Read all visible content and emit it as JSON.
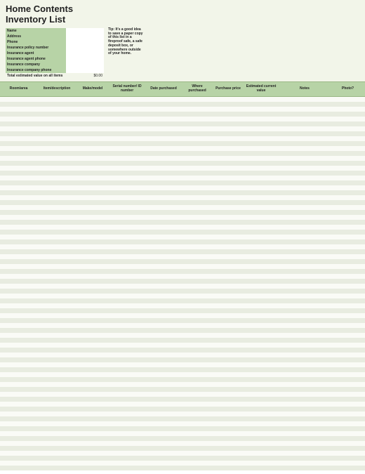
{
  "title_line1": "Home Contents",
  "title_line2": "Inventory List",
  "info": {
    "rows": [
      {
        "label": "Name",
        "value": ""
      },
      {
        "label": "Address",
        "value": ""
      },
      {
        "label": "Phone",
        "value": ""
      },
      {
        "label": "Insurance policy number",
        "value": ""
      },
      {
        "label": "Insurance agent",
        "value": ""
      },
      {
        "label": "Insurance agent phone",
        "value": ""
      },
      {
        "label": "Insurance company",
        "value": ""
      },
      {
        "label": "Insurance company phone",
        "value": ""
      }
    ],
    "total_label": "Total estimated value on all items",
    "total_value": "$0.00"
  },
  "tip": "Tip: It's a good idea to save a paper copy of this list in a fireproof safe, a safe deposit box, or somewhere outside of your home.",
  "columns": [
    "Room/area",
    "Item/description",
    "Make/model",
    "Serial number/ ID number",
    "Date purchased",
    "Where purchased",
    "Purchase price",
    "Estimated current value",
    "Notes",
    "Photo?"
  ],
  "row_count": 76
}
